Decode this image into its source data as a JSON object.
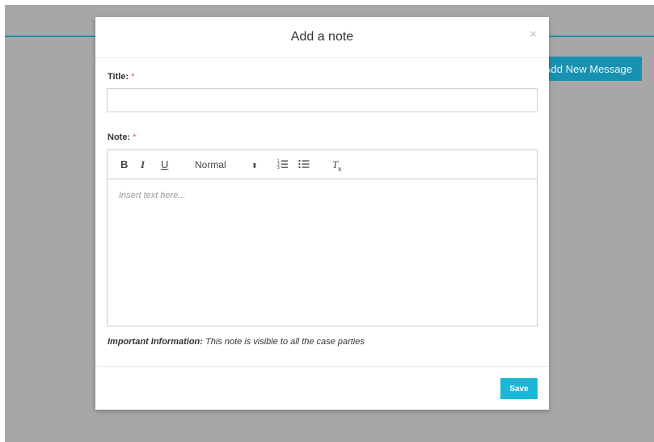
{
  "background": {
    "add_message_button": "Add New Message"
  },
  "modal": {
    "title": "Add a note",
    "close_glyph": "×",
    "title_field": {
      "label": "Title:",
      "required_mark": "*",
      "value": "",
      "placeholder": ""
    },
    "note_field": {
      "label": "Note:",
      "required_mark": "*",
      "placeholder": "Insert text here..."
    },
    "toolbar": {
      "bold": "B",
      "italic": "I",
      "underline": "U",
      "size_select": "Normal",
      "size_arrow": "⬍",
      "ordered_list_icon": "ordered-list-icon",
      "bullet_list_icon": "bullet-list-icon",
      "clean_format": "T",
      "clean_format_sub": "x"
    },
    "info": {
      "label": "Important Information:",
      "text": " This note is visible to all the case parties"
    },
    "save_label": "Save"
  },
  "colors": {
    "backdrop": "#a7a7a7",
    "accent_line": "#1f8fa8",
    "save_button": "#1ab8d6",
    "required": "#d9534f"
  }
}
